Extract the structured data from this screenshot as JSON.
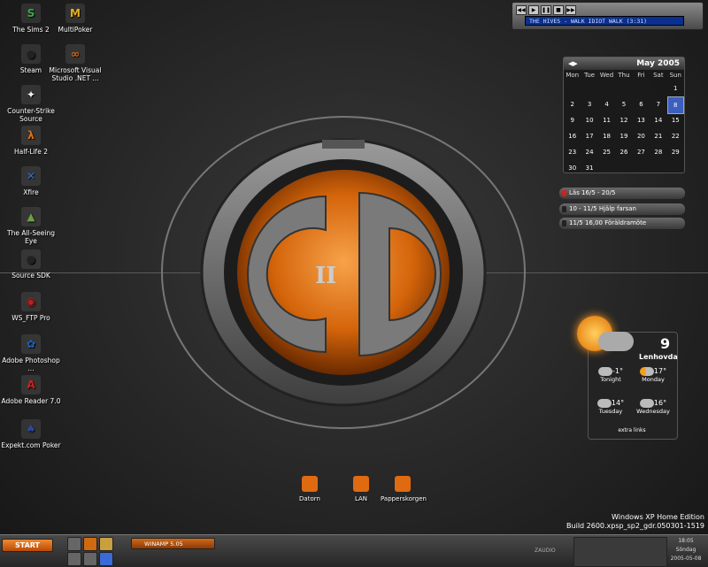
{
  "desktop_icons": [
    {
      "label": "The Sims 2",
      "glyph": "S",
      "color": "#3fa74a"
    },
    {
      "label": "MultiPoker",
      "glyph": "M",
      "color": "#e8b020"
    },
    {
      "label": "Steam",
      "glyph": "●",
      "color": "#222222"
    },
    {
      "label": "Microsoft Visual Studio .NET ...",
      "glyph": "∞",
      "color": "#e06a10"
    },
    {
      "label": "Counter-Strike Source",
      "glyph": "✦",
      "color": "#f0f0f0"
    },
    {
      "label": "Half-Life 2",
      "glyph": "λ",
      "color": "#e07010"
    },
    {
      "label": "Xfire",
      "glyph": "✕",
      "color": "#3a6ad8"
    },
    {
      "label": "The All-Seeing Eye",
      "glyph": "▲",
      "color": "#6aa04a"
    },
    {
      "label": "Source SDK",
      "glyph": "●",
      "color": "#222222"
    },
    {
      "label": "WS_FTP Pro",
      "glyph": "◉",
      "color": "#c02020"
    },
    {
      "label": "Adobe Photoshop ...",
      "glyph": "✿",
      "color": "#2060c0"
    },
    {
      "label": "Adobe Reader 7.0",
      "glyph": "A",
      "color": "#d02020"
    },
    {
      "label": "Expekt.com Poker",
      "glyph": "♠",
      "color": "#2a4aa0"
    }
  ],
  "winamp": {
    "track": "THE HIVES - WALK IDIOT WALK (3:31)",
    "buttons": [
      "◀◀",
      "▶",
      "❚❚",
      "■",
      "▶▶"
    ]
  },
  "calendar": {
    "title": "May 2005",
    "weekdays": [
      "Mon",
      "Tue",
      "Wed",
      "Thu",
      "Fri",
      "Sat",
      "Sun"
    ],
    "weeks": [
      [
        "",
        "",
        "",
        "",
        "",
        "",
        "1"
      ],
      [
        "2",
        "3",
        "4",
        "5",
        "6",
        "7",
        "8"
      ],
      [
        "9",
        "10",
        "11",
        "12",
        "13",
        "14",
        "15"
      ],
      [
        "16",
        "17",
        "18",
        "19",
        "20",
        "21",
        "22"
      ],
      [
        "23",
        "24",
        "25",
        "26",
        "27",
        "28",
        "29"
      ],
      [
        "30",
        "31",
        "",
        "",
        "",
        "",
        ""
      ]
    ],
    "today": "8"
  },
  "todos": [
    "Läs 16/5 - 20/5",
    "10 - 11/5 Hjälp farsan",
    "11/5 16,00 Föräldramöte"
  ],
  "weather": {
    "current_temp": "9",
    "location": "Lenhovda",
    "forecast": [
      {
        "temp": "-1°",
        "day": "Tonight"
      },
      {
        "temp": "17°",
        "day": "Monday"
      },
      {
        "temp": "14°",
        "day": "Tuesday"
      },
      {
        "temp": "16°",
        "day": "Wednesday"
      }
    ],
    "extra": "extra links"
  },
  "bottom_icons": [
    "Datorn",
    "LAN",
    "Papperskorgen"
  ],
  "windows_version": {
    "line1": "Windows XP Home Edition",
    "line2": "Build 2600.xpsp_sp2_gdr.050301-1519"
  },
  "taskbar": {
    "start_label": "START",
    "task": "WINAMP 5.05",
    "clock_time": "18:05",
    "clock_day": "Söndag",
    "clock_date": "2005-05-08",
    "zaudio": "ZAUDIO"
  }
}
